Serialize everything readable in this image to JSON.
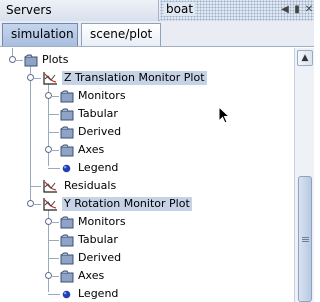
{
  "window": {
    "left_title": "Servers",
    "right_title": "boat",
    "buttons": {
      "minimize_glyph": "◀",
      "restore_glyph": "▮",
      "close_glyph": "✕"
    }
  },
  "tabs": [
    {
      "label": "simulation",
      "active": true
    },
    {
      "label": "scene/plot",
      "active": false
    }
  ],
  "tree": {
    "root": {
      "label": "Plots"
    },
    "plot1": {
      "label": "Z Translation Monitor Plot",
      "children": [
        "Monitors",
        "Tabular",
        "Derived",
        "Axes",
        "Legend"
      ]
    },
    "residuals": {
      "label": "Residuals"
    },
    "plot2": {
      "label": "Y Rotation Monitor Plot",
      "children": [
        "Monitors",
        "Tabular",
        "Derived",
        "Axes",
        "Legend"
      ]
    }
  },
  "colors": {
    "selection": "#c6d3e6",
    "folder": "#8fa3c8",
    "legend_dot": "#1f3fb8"
  },
  "icons": {
    "folder": "folder-icon",
    "plot": "plot-icon",
    "legend": "legend-dot-icon",
    "expand": "expand-handle-icon"
  }
}
